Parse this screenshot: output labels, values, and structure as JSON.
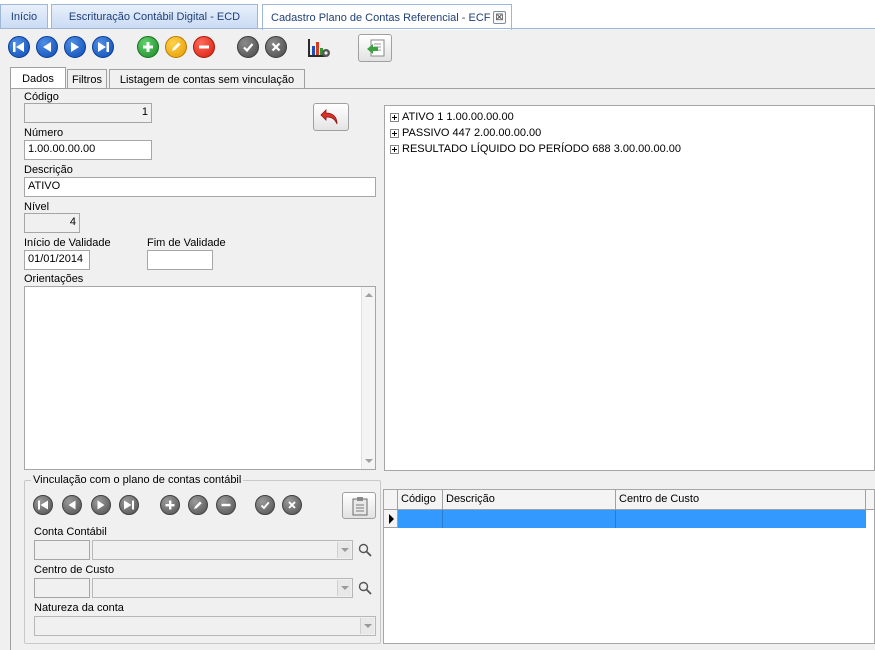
{
  "doc_tabs": [
    {
      "label": "Início"
    },
    {
      "label": "Escrituração Contábil Digital - ECD"
    },
    {
      "label": "Cadastro Plano de Contas Referencial - ECF",
      "close": "⊠"
    }
  ],
  "form_tabs": [
    "Dados",
    "Filtros",
    "Listagem de contas sem vinculação"
  ],
  "form": {
    "codigo_label": "Código",
    "codigo_value": "1",
    "numero_label": "Número",
    "numero_value": "1.00.00.00.00",
    "descricao_label": "Descrição",
    "descricao_value": "ATIVO",
    "nivel_label": "Nível",
    "nivel_value": "4",
    "inicio_label": "Início de Validade",
    "inicio_value": "01/01/2014",
    "fim_label": "Fim de Validade",
    "fim_value": "",
    "orientacoes_label": "Orientações",
    "orientacoes_value": ""
  },
  "tree": [
    {
      "label": "ATIVO 1 1.00.00.00.00"
    },
    {
      "label": "PASSIVO 447 2.00.00.00.00"
    },
    {
      "label": "RESULTADO LÍQUIDO DO PERÍODO 688 3.00.00.00.00"
    }
  ],
  "vinculacao": {
    "title": "Vinculação com o plano de contas contábil",
    "conta_contabil_label": "Conta Contábil",
    "centro_custo_label": "Centro de Custo",
    "natureza_label": "Natureza da conta",
    "grid_columns": [
      "Código",
      "Descrição",
      "Centro de Custo"
    ]
  },
  "colors": {
    "nav_blue": "#0d4bb3",
    "add_green": "#1d8a26",
    "edit_orange": "#e59a00",
    "delete_red": "#d61c0c",
    "grid_selection": "#3399ff",
    "tab_text": "#1f3f78"
  },
  "icons": {
    "toolbar": [
      "first-record-icon",
      "previous-record-icon",
      "next-record-icon",
      "last-record-icon",
      "add-icon",
      "edit-icon",
      "delete-icon",
      "confirm-icon",
      "cancel-icon",
      "report-chart-icon",
      "import-icon"
    ],
    "undo": "undo-icon",
    "search": "magnifier-icon"
  }
}
